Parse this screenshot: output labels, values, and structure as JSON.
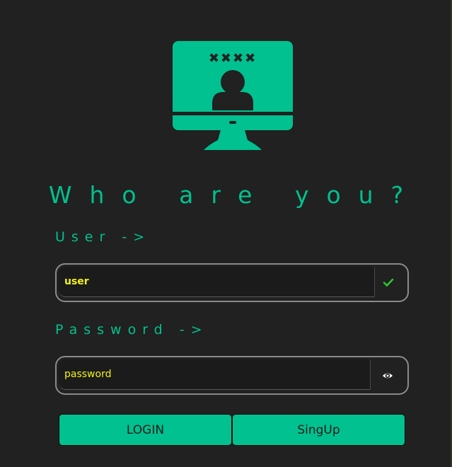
{
  "title": "Who are you?",
  "user_field": {
    "label": "User ->",
    "value": "user",
    "status_icon": "check-icon"
  },
  "password_field": {
    "label": "Password ->",
    "value": "password",
    "toggle_icon": "eye-icon"
  },
  "buttons": {
    "login_label": "LOGIN",
    "signup_label": "SingUp"
  },
  "logo": {
    "icon": "computer-user-login-icon",
    "mask_text": "✖✖✖✖"
  },
  "colors": {
    "background": "#212121",
    "accent": "#00c18f",
    "input_text": "#f1f11a",
    "border": "#8a8a8a"
  }
}
